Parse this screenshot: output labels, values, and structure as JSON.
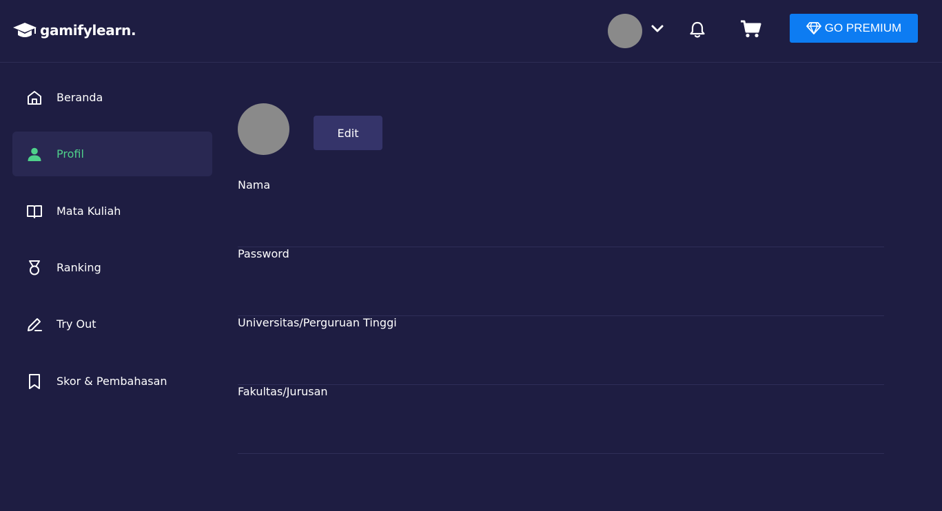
{
  "header": {
    "logo_text": "gamifylearn.",
    "premium_label": "GO PREMIUM",
    "icons": {
      "logo": "graduation-cap-icon",
      "menu": "chevron-down-icon",
      "notifications": "bell-icon",
      "cart": "cart-icon",
      "premium": "diamond-icon"
    },
    "colors": {
      "premium_bg": "#0d7cf2",
      "background": "#1e1d42"
    }
  },
  "sidebar": {
    "items": [
      {
        "label": "Beranda",
        "icon": "home-icon",
        "active": false
      },
      {
        "label": "Profil",
        "icon": "user-icon",
        "active": true
      },
      {
        "label": "Mata Kuliah",
        "icon": "book-icon",
        "active": false
      },
      {
        "label": "Ranking",
        "icon": "medal-icon",
        "active": false
      },
      {
        "label": "Try Out",
        "icon": "pencil-icon",
        "active": false
      },
      {
        "label": "Skor & Pembahasan",
        "icon": "bookmark-icon",
        "active": false
      }
    ],
    "colors": {
      "active_text": "#4fd18b",
      "active_bg": "#292852"
    }
  },
  "profile": {
    "edit_label": "Edit",
    "fields": [
      {
        "label": "Nama",
        "value": ""
      },
      {
        "label": "Password",
        "value": ""
      },
      {
        "label": "Universitas/Perguruan Tinggi",
        "value": ""
      },
      {
        "label": "Fakultas/Jurusan",
        "value": ""
      }
    ]
  }
}
